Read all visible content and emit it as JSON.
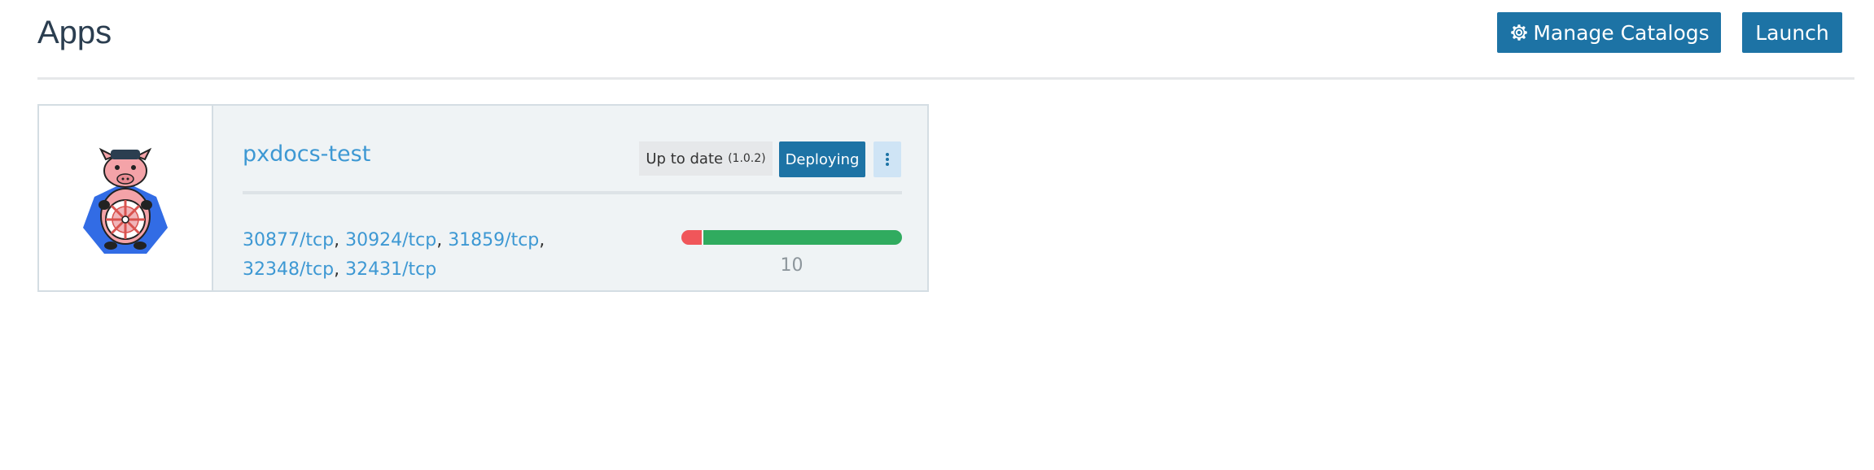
{
  "header": {
    "title": "Apps",
    "manage_catalogs_label": "Manage Catalogs",
    "launch_label": "Launch"
  },
  "apps": [
    {
      "name": "pxdocs-test",
      "status": "Up to date",
      "version": "(1.0.2)",
      "state": "Deploying",
      "ports": [
        "30877/tcp",
        "30924/tcp",
        "31859/tcp",
        "32348/tcp",
        "32431/tcp"
      ],
      "count": "10",
      "health": {
        "unhealthy_fraction": 0.1,
        "healthy_fraction": 0.9
      }
    }
  ],
  "colors": {
    "primary": "#1d73a5",
    "link": "#3d98d3",
    "unhealthy": "#f0565a",
    "healthy": "#30ab5f"
  },
  "icons": {
    "manage_catalogs": "gear-icon",
    "more_actions": "vertical-dots-icon",
    "app_logo": "kubernetes-pig-logo"
  }
}
